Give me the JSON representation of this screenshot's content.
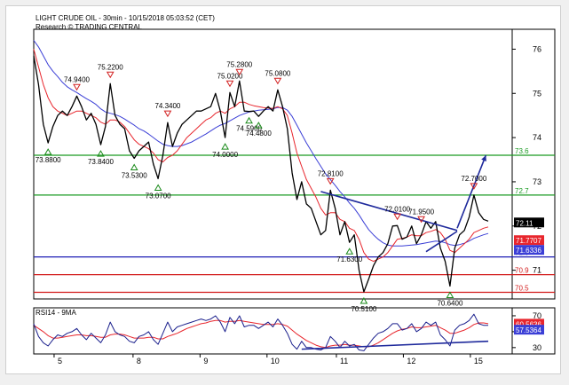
{
  "header": {
    "title": "LIGHT CRUDE OIL - 30min - 10/15/2018 05:03:52 (CET)",
    "credit": "Research © TRADING CENTRAL"
  },
  "colors": {
    "price": "#000000",
    "ma_fast": "#e8262d",
    "ma_slow": "#3b3fd6",
    "support_green": "#1a9a22",
    "support_blue": "#1d1db5",
    "support_red": "#d21a1a",
    "trend": "#1f2a9c",
    "marker_up": "#1a8a1a",
    "marker_down": "#d22020",
    "rsi": "#1a1f8c",
    "rsi_ma": "#e8262d"
  },
  "chart_data": [
    {
      "type": "line",
      "title": "LIGHT CRUDE OIL - 30min - 10/15/2018 05:03:52 (CET)",
      "x_ticks": [
        "5",
        "8",
        "9",
        "10",
        "11",
        "12",
        "15"
      ],
      "y_ticks": [
        71,
        72,
        73,
        74,
        75,
        76
      ],
      "ylim": [
        70.35,
        76.45
      ],
      "xlim": [
        0,
        100
      ],
      "grid": false,
      "price_x": [
        0,
        1,
        2,
        3,
        4,
        5,
        6,
        7,
        8,
        9,
        10,
        11,
        12,
        13,
        14,
        15,
        16,
        17,
        18,
        19,
        20,
        21,
        22,
        23,
        24,
        25,
        26,
        27,
        28,
        29,
        30,
        31,
        32,
        33,
        34,
        35,
        36,
        37,
        38,
        39,
        40,
        41,
        42,
        43,
        44,
        45,
        46,
        47,
        48,
        49,
        50,
        51,
        52,
        53,
        54,
        55,
        56,
        57,
        58,
        59,
        60,
        61,
        62,
        63,
        64,
        65,
        66,
        67,
        68,
        69,
        70,
        71,
        72,
        73,
        74,
        75,
        76,
        77,
        78,
        79,
        80,
        81,
        82,
        83,
        84,
        85,
        86,
        87,
        88,
        89,
        90,
        91,
        92,
        93,
        94,
        95
      ],
      "series": [
        {
          "name": "price",
          "values": [
            75.85,
            75.2,
            74.3,
            73.88,
            74.25,
            74.5,
            74.6,
            74.5,
            74.7,
            74.94,
            74.7,
            74.4,
            74.55,
            74.3,
            73.84,
            74.25,
            75.22,
            74.5,
            74.3,
            74.2,
            73.7,
            73.53,
            73.7,
            73.8,
            73.9,
            73.4,
            73.07,
            73.6,
            74.34,
            73.8,
            74.1,
            74.3,
            74.4,
            74.5,
            74.6,
            74.6,
            74.65,
            74.7,
            75.0,
            74.6,
            74.0,
            75.02,
            74.7,
            75.28,
            74.6,
            74.59,
            74.6,
            74.48,
            74.6,
            74.7,
            74.6,
            75.08,
            74.7,
            74.2,
            73.2,
            72.6,
            73.0,
            72.5,
            72.4,
            72.1,
            71.8,
            71.9,
            72.81,
            72.4,
            71.8,
            72.1,
            71.63,
            71.8,
            71.0,
            70.51,
            70.8,
            71.1,
            71.3,
            71.4,
            71.6,
            72.0,
            72.01,
            71.7,
            71.75,
            72.0,
            71.6,
            71.8,
            72.1,
            71.95,
            72.1,
            71.5,
            71.2,
            70.64,
            71.5,
            71.8,
            71.9,
            72.2,
            72.7,
            72.3,
            72.15,
            72.11
          ]
        },
        {
          "name": "ma_fast",
          "values": [
            76.0,
            75.6,
            75.2,
            74.9,
            74.7,
            74.6,
            74.55,
            74.5,
            74.55,
            74.6,
            74.6,
            74.55,
            74.5,
            74.45,
            74.35,
            74.3,
            74.4,
            74.4,
            74.35,
            74.25,
            74.1,
            73.95,
            73.85,
            73.8,
            73.75,
            73.65,
            73.5,
            73.45,
            73.55,
            73.6,
            73.7,
            73.85,
            74.0,
            74.1,
            74.2,
            74.3,
            74.4,
            74.45,
            74.55,
            74.6,
            74.55,
            74.65,
            74.7,
            74.8,
            74.8,
            74.75,
            74.72,
            74.7,
            74.68,
            74.67,
            74.66,
            74.7,
            74.65,
            74.5,
            74.1,
            73.65,
            73.35,
            73.05,
            72.85,
            72.65,
            72.4,
            72.25,
            72.3,
            72.3,
            72.15,
            72.1,
            71.95,
            71.9,
            71.7,
            71.4,
            71.25,
            71.2,
            71.25,
            71.3,
            71.4,
            71.55,
            71.7,
            71.72,
            71.75,
            71.8,
            71.78,
            71.78,
            71.85,
            71.88,
            71.92,
            71.85,
            71.7,
            71.45,
            71.4,
            71.5,
            71.6,
            71.7,
            71.85,
            71.9,
            71.95,
            71.98
          ]
        },
        {
          "name": "ma_slow",
          "values": [
            76.2,
            76.05,
            75.85,
            75.65,
            75.5,
            75.38,
            75.25,
            75.15,
            75.08,
            75.02,
            74.95,
            74.88,
            74.82,
            74.75,
            74.65,
            74.58,
            74.55,
            74.52,
            74.48,
            74.42,
            74.35,
            74.28,
            74.2,
            74.15,
            74.08,
            74.0,
            73.92,
            73.85,
            73.82,
            73.8,
            73.8,
            73.82,
            73.86,
            73.9,
            73.96,
            74.02,
            74.08,
            74.15,
            74.22,
            74.28,
            74.32,
            74.38,
            74.44,
            74.5,
            74.54,
            74.58,
            74.6,
            74.62,
            74.63,
            74.64,
            74.65,
            74.68,
            74.68,
            74.62,
            74.48,
            74.28,
            74.08,
            73.88,
            73.7,
            73.52,
            73.35,
            73.18,
            73.05,
            72.92,
            72.78,
            72.66,
            72.52,
            72.4,
            72.25,
            72.08,
            71.92,
            71.8,
            71.7,
            71.62,
            71.57,
            71.55,
            71.55,
            71.55,
            71.56,
            71.57,
            71.58,
            71.6,
            71.62,
            71.64,
            71.66,
            71.65,
            71.62,
            71.58,
            71.56,
            71.58,
            71.61,
            71.66,
            71.72,
            71.76,
            71.8,
            71.83
          ]
        }
      ],
      "levels": [
        {
          "value": 73.6,
          "label": "73.6",
          "color": "green"
        },
        {
          "value": 72.7,
          "label": "72.7",
          "color": "green"
        },
        {
          "value": 71.3,
          "label": "71.3",
          "color": "blue"
        },
        {
          "value": 70.9,
          "label": "70.9",
          "color": "red"
        },
        {
          "value": 70.5,
          "label": "70.5",
          "color": "red"
        }
      ],
      "trendlines": [
        {
          "from": [
            60,
            72.78
          ],
          "to": [
            88.5,
            71.9
          ]
        },
        {
          "from": [
            82,
            71.42
          ],
          "to": [
            88.5,
            71.88
          ]
        }
      ],
      "projection": {
        "from": [
          88.5,
          71.95
        ],
        "to": [
          94.5,
          73.6
        ]
      },
      "markers": [
        {
          "x": 3,
          "value": 73.88,
          "label": "73.8800",
          "kind": "low"
        },
        {
          "x": 9,
          "value": 74.94,
          "label": "74.9400",
          "kind": "high"
        },
        {
          "x": 14,
          "value": 73.84,
          "label": "73.8400",
          "kind": "low"
        },
        {
          "x": 16,
          "value": 75.22,
          "label": "75.2200",
          "kind": "high"
        },
        {
          "x": 21,
          "value": 73.53,
          "label": "73.5300",
          "kind": "low"
        },
        {
          "x": 26,
          "value": 73.07,
          "label": "73.0700",
          "kind": "low"
        },
        {
          "x": 28,
          "value": 74.34,
          "label": "74.3400",
          "kind": "high"
        },
        {
          "x": 40,
          "value": 74.0,
          "label": "74.0000",
          "kind": "low"
        },
        {
          "x": 41,
          "value": 75.02,
          "label": "75.0200",
          "kind": "high"
        },
        {
          "x": 43,
          "value": 75.28,
          "label": "75.2800",
          "kind": "high"
        },
        {
          "x": 45,
          "value": 74.59,
          "label": "74.5900",
          "kind": "low"
        },
        {
          "x": 47,
          "value": 74.48,
          "label": "74.4800",
          "kind": "low"
        },
        {
          "x": 51,
          "value": 75.08,
          "label": "75.0800",
          "kind": "high"
        },
        {
          "x": 62,
          "value": 72.81,
          "label": "72.8100",
          "kind": "high"
        },
        {
          "x": 66,
          "value": 71.63,
          "label": "71.6300",
          "kind": "low"
        },
        {
          "x": 69,
          "value": 70.51,
          "label": "70.5100",
          "kind": "low"
        },
        {
          "x": 76,
          "value": 72.01,
          "label": "72.0100",
          "kind": "high"
        },
        {
          "x": 81,
          "value": 71.95,
          "label": "71.9500",
          "kind": "high"
        },
        {
          "x": 87,
          "value": 70.64,
          "label": "70.6400",
          "kind": "low"
        },
        {
          "x": 92,
          "value": 72.7,
          "label": "72.7000",
          "kind": "high"
        }
      ],
      "last_values": [
        {
          "value": 72.11,
          "label": "72.11",
          "color": "black"
        },
        {
          "value": 71.77,
          "label": "71.7707",
          "color": "red"
        },
        {
          "value": 71.63,
          "label": "71.6336",
          "color": "blue"
        }
      ]
    },
    {
      "type": "line",
      "title": "RSI14 - 9MA",
      "y_ticks": [
        30,
        50,
        70
      ],
      "ylim": [
        22,
        80
      ],
      "xlim": [
        0,
        100
      ],
      "series": [
        {
          "name": "RSI14",
          "values": [
            60,
            44,
            36,
            32,
            40,
            46,
            44,
            48,
            50,
            54,
            46,
            40,
            48,
            42,
            36,
            46,
            62,
            50,
            46,
            44,
            38,
            36,
            44,
            46,
            50,
            40,
            34,
            48,
            62,
            50,
            56,
            58,
            60,
            62,
            64,
            66,
            64,
            66,
            70,
            62,
            50,
            68,
            60,
            70,
            56,
            58,
            58,
            54,
            58,
            62,
            56,
            66,
            58,
            48,
            34,
            28,
            38,
            30,
            30,
            28,
            27,
            30,
            44,
            38,
            30,
            38,
            32,
            34,
            27,
            26,
            34,
            42,
            48,
            50,
            54,
            60,
            60,
            52,
            54,
            60,
            50,
            54,
            62,
            58,
            62,
            46,
            40,
            32,
            52,
            58,
            60,
            64,
            72,
            60,
            58,
            58
          ]
        },
        {
          "name": "9MA",
          "values": [
            58,
            54,
            50,
            45,
            42,
            42,
            43,
            44,
            45,
            46,
            46,
            45,
            45,
            44,
            43,
            43,
            46,
            47,
            47,
            46,
            44,
            42,
            42,
            42,
            43,
            43,
            41,
            41,
            44,
            46,
            48,
            51,
            54,
            56,
            58,
            60,
            61,
            63,
            64,
            64,
            62,
            63,
            63,
            64,
            63,
            62,
            61,
            60,
            59,
            59,
            59,
            60,
            59,
            57,
            52,
            47,
            43,
            39,
            36,
            33,
            31,
            30,
            32,
            33,
            33,
            34,
            33,
            33,
            32,
            31,
            31,
            33,
            36,
            40,
            44,
            48,
            51,
            53,
            54,
            56,
            55,
            55,
            56,
            57,
            58,
            55,
            52,
            48,
            48,
            50,
            52,
            55,
            59,
            61,
            61,
            60
          ]
        }
      ],
      "trendline": {
        "from": [
          56,
          28
        ],
        "to": [
          95,
          38
        ]
      },
      "last_values": [
        {
          "value": 60.56,
          "label": "60.5636",
          "color": "red"
        },
        {
          "value": 57.54,
          "label": "57.5364",
          "color": "blue"
        }
      ]
    }
  ]
}
